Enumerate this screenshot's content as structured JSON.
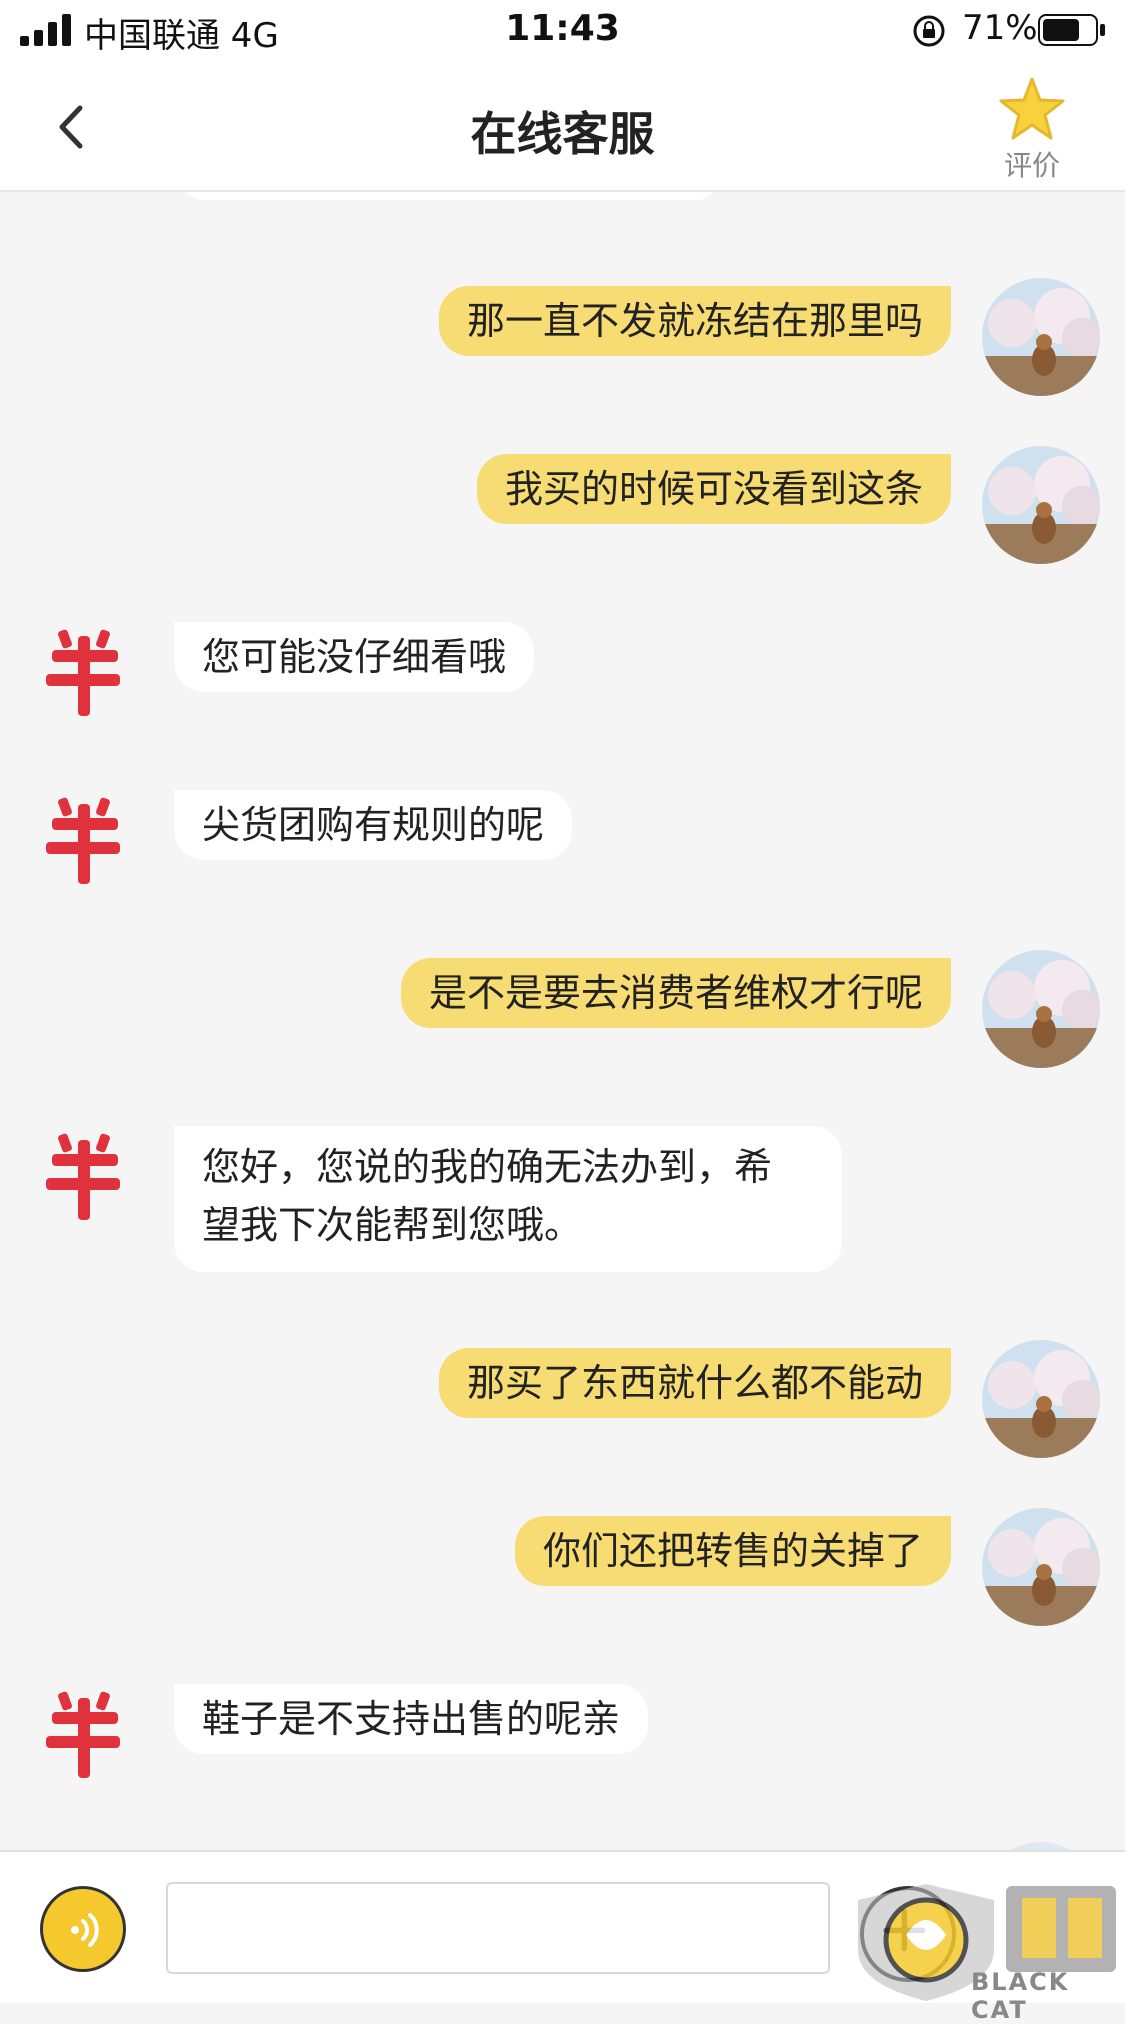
{
  "status_bar": {
    "carrier": "中国联通   4G",
    "time": "11:43",
    "battery_percent": "71%",
    "battery_level": 0.71
  },
  "nav": {
    "back_icon": "chevron-left-icon",
    "title": "在线客服",
    "rate_label": "评价",
    "rate_icon": "star-icon"
  },
  "colors": {
    "user_bubble": "#f6dc73",
    "agent_bubble": "#ffffff",
    "background": "#f5f5f5",
    "accent": "#f5c92e",
    "agent_avatar": "#e0323c"
  },
  "messages": [
    {
      "side": "right",
      "text": "那一直不发就冻结在那里吗"
    },
    {
      "side": "right",
      "text": "我买的时候可没看到这条"
    },
    {
      "side": "left",
      "text": "您可能没仔细看哦"
    },
    {
      "side": "left",
      "text": "尖货团购有规则的呢"
    },
    {
      "side": "right",
      "text": "是不是要去消费者维权才行呢"
    },
    {
      "side": "left",
      "text": "您好，您说的我的确无法办到，希望我下次能帮到您哦。"
    },
    {
      "side": "right",
      "text": "那买了东西就什么都不能动"
    },
    {
      "side": "right",
      "text": "你们还把转售的关掉了"
    },
    {
      "side": "left",
      "text": "鞋子是不支持出售的呢亲"
    }
  ],
  "input_bar": {
    "voice_icon": "voice-icon",
    "input_value": "",
    "plus_icon": "plus-icon"
  },
  "watermark": {
    "text": "BLACK CAT"
  }
}
